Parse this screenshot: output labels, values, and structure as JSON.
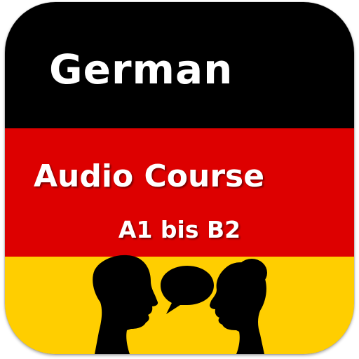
{
  "icon": {
    "title": "German",
    "subtitle": "Audio Course",
    "level": "A1 bis B2"
  },
  "colors": {
    "black": "#000000",
    "red": "#dd0000",
    "gold": "#ffce00",
    "text": "#ffffff"
  },
  "art": {
    "icons": [
      "left-face-silhouette-icon",
      "speech-bubble-icon",
      "right-face-silhouette-icon"
    ]
  }
}
